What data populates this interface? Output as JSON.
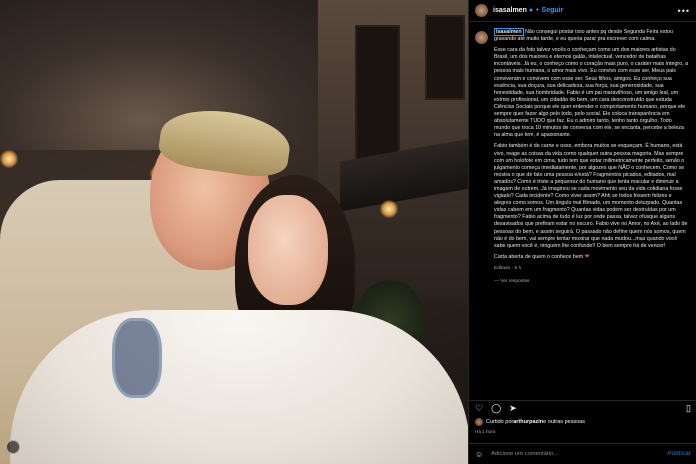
{
  "post": {
    "username": "isasalmen",
    "verified_icon": "verified-badge-icon",
    "separator": "•",
    "follow_label": "Seguir",
    "more_label": "•••"
  },
  "caption": {
    "username": "isasalmen",
    "p1": "Não consegui postar isso antes pq desde Segunda Feira estou gravando até muito tarde, e eu queria parar pra escrever com calma.",
    "p2": "Esse cara da foto talvez vocês o conheçam como um dos maiores artistas do Brasil, um dos maiores e eternos galãs, intelectual, vencedor de batalhas incontáveis. Já eu, o conheço como o coração mais puro, o caráter mais íntegro, a pessoa mais humana, o amor mais vivo. Eu convivo com esse ser. Meus pais conviveram e convivem com esse ser. Seus filhos, amigos. Eu conheço sua essência, sua doçura, sua delicadeza, sua força, sua generosidade, sua honestidade, sua hombridade. Fabio é um pai maravilhoso, um amigo leal, um exímio profissional, um cidadão do bem, um cara desconstruído que estuda Ciências Sociais porque ele quer entender o comportamento humano, porque ele sempre quer fazer algo pelo todo, pelo social. Ele coloca transparência em absolutamente TUDO que faz. Eu o admiro tanto, tenho tanto orgulho. Todo mundo que troca 10 minutos de conversa com ele, se encanta, percebe a beleza na alma que tem, é apaixonante.",
    "p3": "Fabio também é de carne e osso, embora muitos se esqueçam. É humano, está vivo, reage as coisas da vida como qualquer outra pessoa magoria. Mas sempre com um holofote em cima, tudo tem que estar milimetricamente perfeito, senão o julgamento começa imediatamente, por algozes que NÃO o conhecem. Como se mostra o que de fato uma pessoa é/está? Fragmentos picados, editados, mal amados? Como é triste a pequenez do humano que tenta macular e diminuir a imagem de outrem. Já imaginou se cada movimento seu da vida cotidiana fosse vigiado? Cada incidente? Como viver assim? Ahh se todos fossem felizes e alegres como somos. Um ângulo mal filmado, um momento deturpado. Quantas vidas cabem em um fragmento? Quantas vidas podem ser destruídas por um fragmento? Fabio acima de tudo é luz por onde passa, talvez ofusque alguns desavisados que prefiram estar no escuro. Fabio vive no Amor, no Axé, ao lado de pessoas do bem, e assim seguirá. O passado não define quem nós somos, quem não é do bem, vai sempre tentar mostrar que nada mudou...mas quando você sabe quem você é, ninguém lhe confunde!! O bem sempre há de vencer!",
    "p4": "Carta aberta de quem o conhece bem",
    "p4_emoji": "❤",
    "edited": "Editado · 5 h",
    "reply": "— Ver respostas"
  },
  "actions": {
    "like_icon": "heart-icon",
    "comment_icon": "comment-icon",
    "share_icon": "share-icon",
    "save_icon": "bookmark-icon"
  },
  "likes": {
    "prefix": "Curtido por ",
    "user": "arthurpazin",
    "suffix": " e outras pessoas"
  },
  "timestamp": "Há 1 hora",
  "comment": {
    "placeholder": "Adicione um comentário...",
    "publish_label": "Publicar"
  }
}
